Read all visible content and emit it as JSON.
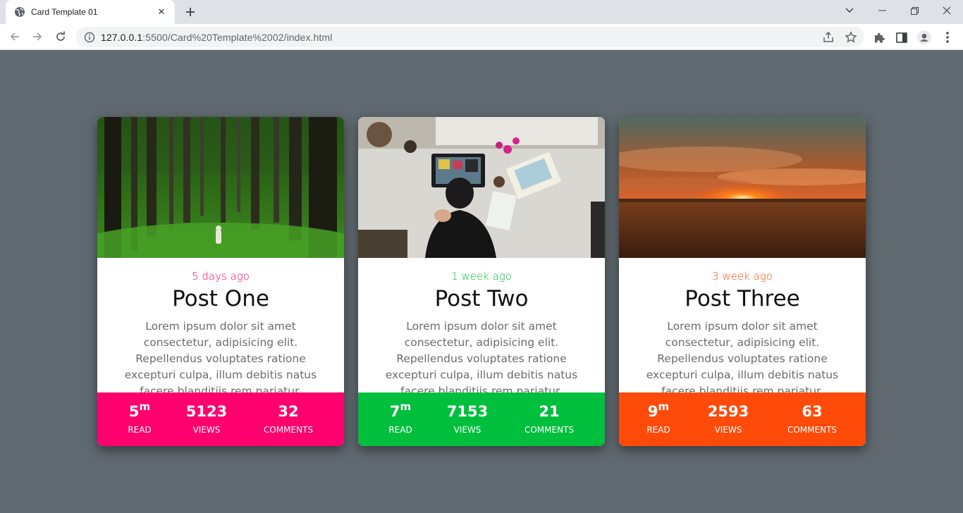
{
  "browser": {
    "tab_title": "Card Template 01",
    "url_host": "127.0.0.1",
    "url_rest": ":5500/Card%20Template%2002/index.html"
  },
  "colors": {
    "page_bg": "#5f696f",
    "card1_accent": "#ff006e",
    "card2_accent": "#00bf3d",
    "card3_accent": "#ff4b0a"
  },
  "cards": [
    {
      "image": "forest photo",
      "date": "5 days ago",
      "title": "Post One",
      "text": "Lorem ipsum dolor sit amet consectetur, adipisicing elit. Repellendus voluptates ratione excepturi culpa, illum debitis natus facere blanditiis rem pariatur.",
      "stats": [
        {
          "value": "5",
          "sup": "m",
          "label": "READ"
        },
        {
          "value": "5123",
          "label": "VIEWS"
        },
        {
          "value": "32",
          "label": "COMMENTS"
        }
      ]
    },
    {
      "image": "desk with artist photo",
      "date": "1 week ago",
      "title": "Post Two",
      "text": "Lorem ipsum dolor sit amet consectetur, adipisicing elit. Repellendus voluptates ratione excepturi culpa, illum debitis natus facere blanditiis rem pariatur.",
      "stats": [
        {
          "value": "7",
          "sup": "m",
          "label": "READ"
        },
        {
          "value": "7153",
          "label": "VIEWS"
        },
        {
          "value": "21",
          "label": "COMMENTS"
        }
      ]
    },
    {
      "image": "sunset over field photo",
      "date": "3 week ago",
      "title": "Post Three",
      "text": "Lorem ipsum dolor sit amet consectetur, adipisicing elit. Repellendus voluptates ratione excepturi culpa, illum debitis natus facere blanditiis rem pariatur.",
      "stats": [
        {
          "value": "9",
          "sup": "m",
          "label": "READ"
        },
        {
          "value": "2593",
          "label": "VIEWS"
        },
        {
          "value": "63",
          "label": "COMMENTS"
        }
      ]
    }
  ]
}
